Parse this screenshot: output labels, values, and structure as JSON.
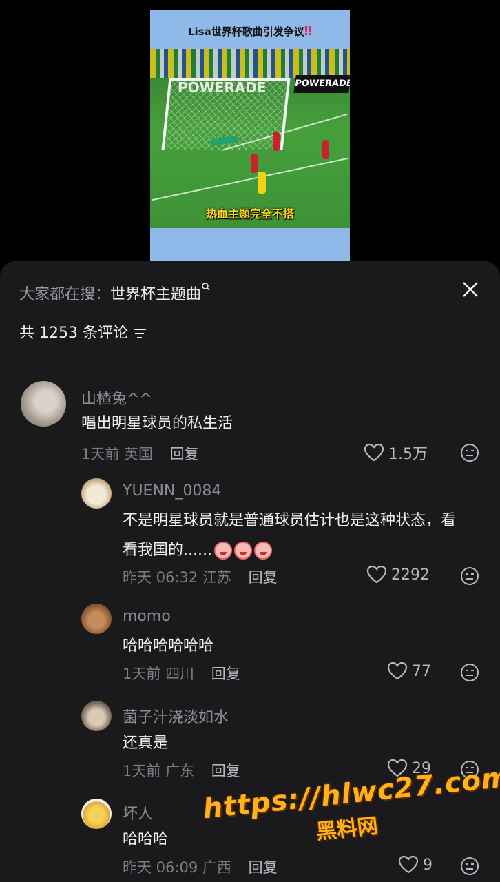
{
  "video": {
    "title": "Lisa世界杯歌曲引发争议",
    "title_mark": "‼",
    "board_text": "POWERADE",
    "goal_text": "POWERADE",
    "caption": "热血主题完全不搭"
  },
  "sheet": {
    "search_prefix": "大家都在搜：",
    "search_keyword": "世界杯主题曲",
    "comment_count": "共 1253 条评论"
  },
  "comments": [
    {
      "user": "山楂兔^^",
      "text": "唱出明星球员的私生活",
      "time": "1天前",
      "location": "英国",
      "reply": "回复",
      "likes": "1.5万"
    },
    {
      "user": "YUENN_0084",
      "text": "不是明星球员就是普通球员估计也是这种状态，看看我国的......",
      "time": "昨天 06:32",
      "location": "江苏",
      "reply": "回复",
      "likes": "2292"
    },
    {
      "user": "momo",
      "text": "哈哈哈哈哈哈",
      "time": "1天前",
      "location": "四川",
      "reply": "回复",
      "likes": "77"
    },
    {
      "user": "菌子汁浇淡如水",
      "text": "还真是",
      "time": "1天前",
      "location": "广东",
      "reply": "回复",
      "likes": "29"
    },
    {
      "user": "坏人",
      "text": "哈哈哈",
      "time": "昨天 06:09",
      "location": "广西",
      "reply": "回复",
      "likes": "9"
    }
  ],
  "watermark": {
    "url": "https://hlwc27.com",
    "name": "黑料网"
  },
  "colors": {
    "sheet_bg": "#1a1a1c",
    "caption": "#ffd21f",
    "watermark": "#ffb21a"
  }
}
